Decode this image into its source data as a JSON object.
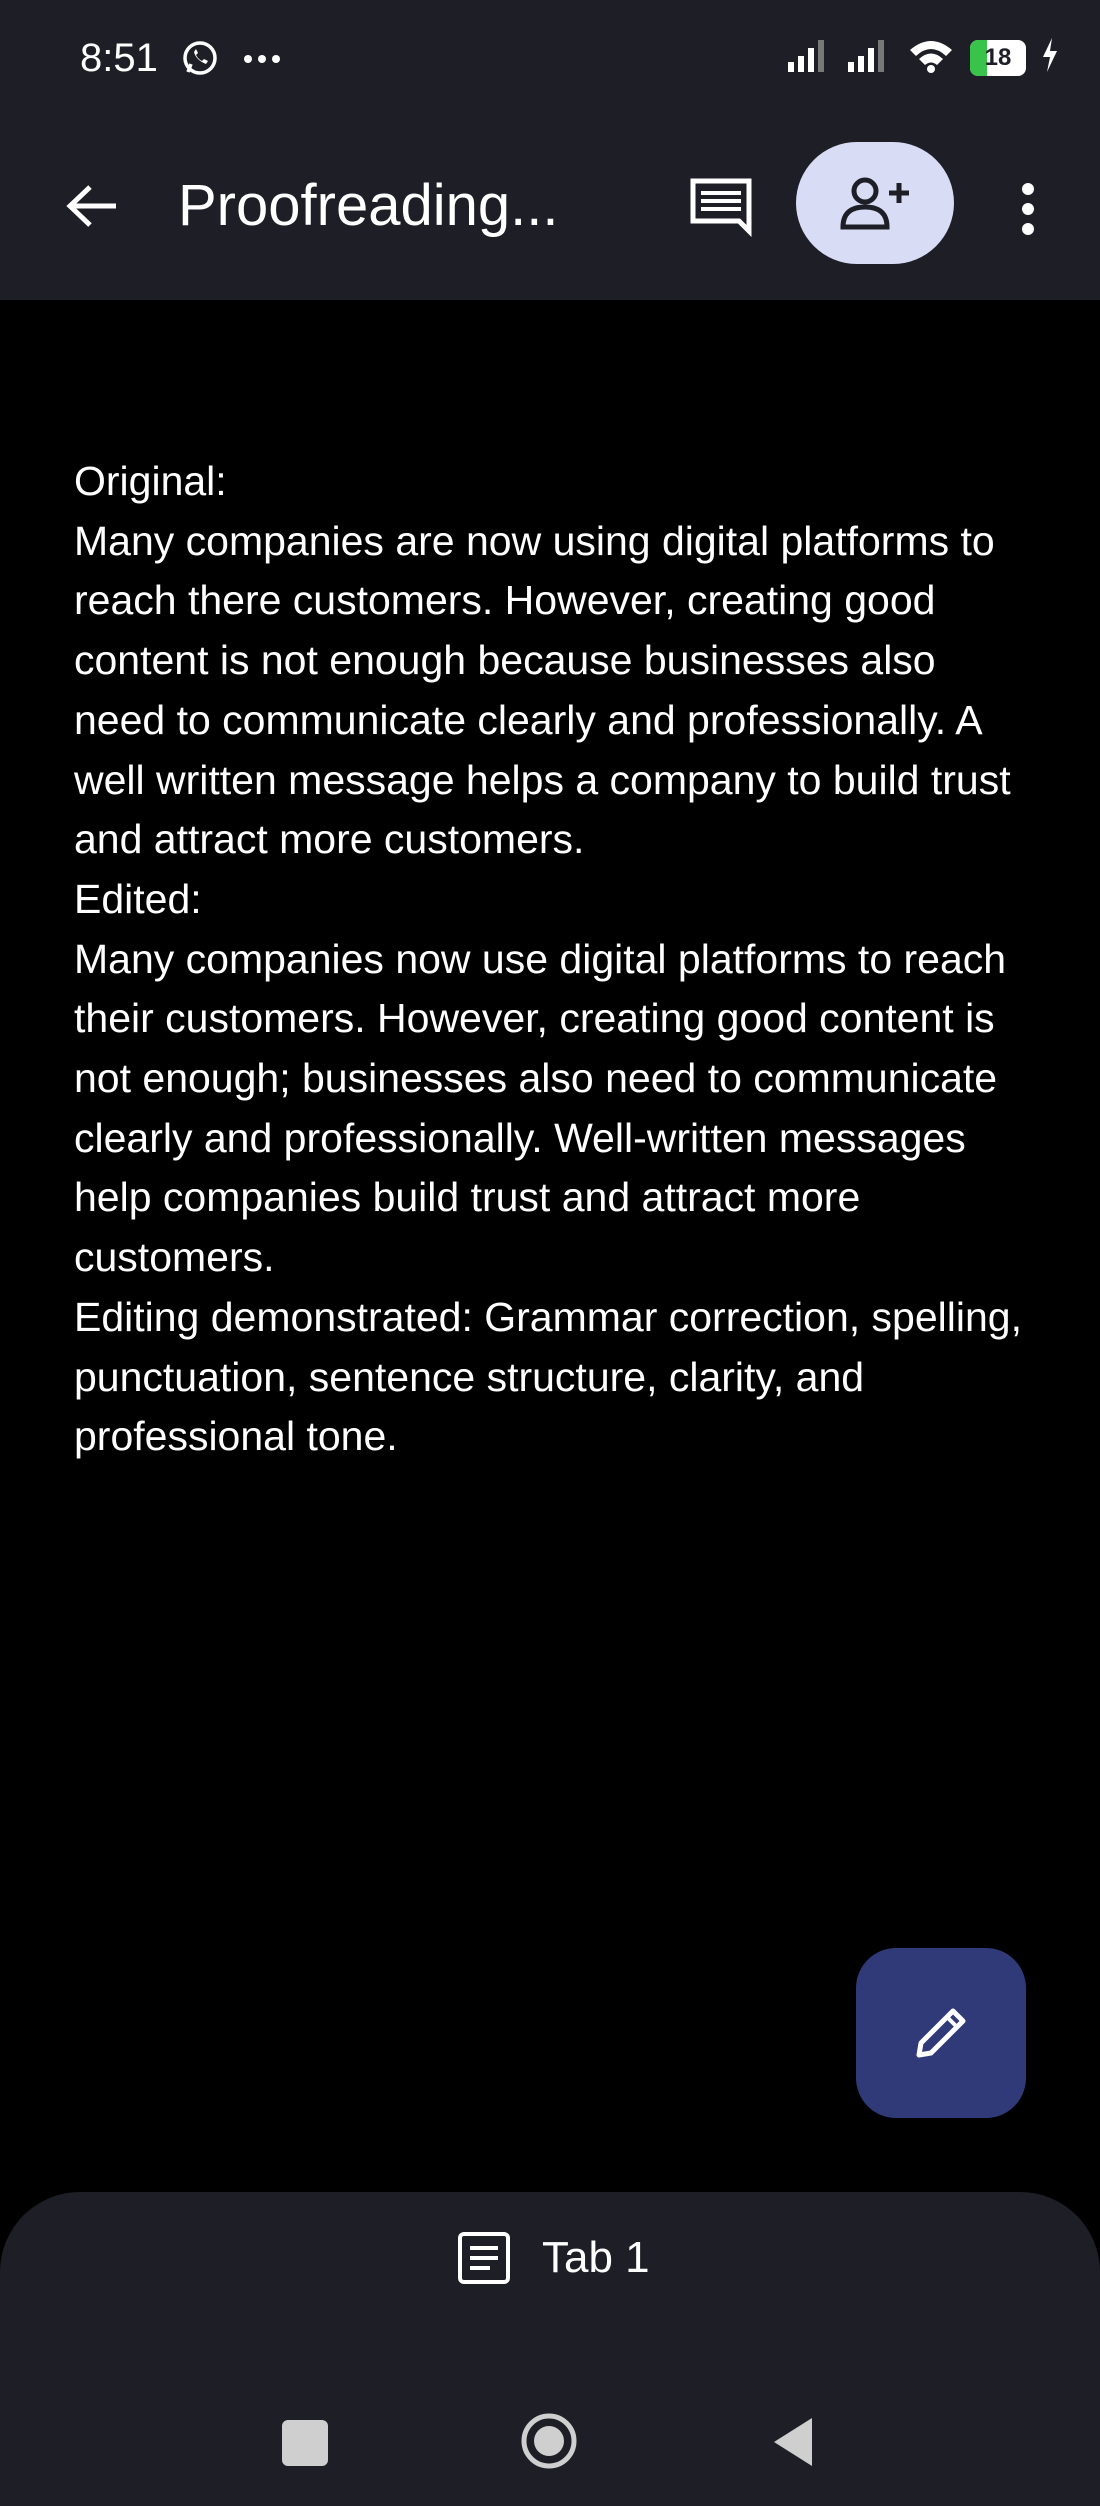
{
  "status_bar": {
    "time": "8:51",
    "left_icons": [
      "whatsapp-icon",
      "more-dots-icon"
    ],
    "right_icons": [
      "signal-icon",
      "signal-icon",
      "wifi-icon",
      "battery-icon",
      "charging-icon"
    ],
    "battery_percent": "18",
    "battery_color": "#3ac34a"
  },
  "app_bar": {
    "title": "Proofreading...",
    "back_icon": "arrow-left-icon",
    "comment_icon": "comment-icon",
    "share_icon": "person-add-icon",
    "more_icon": "more-vert-icon",
    "share_button_color": "#d9dcf5"
  },
  "document": {
    "paragraphs": [
      "Original:",
      "Many companies are now using digital platforms to reach there customers. However, creating good content is not enough because businesses also need to communicate clearly and professionally. A well written message helps a company to build trust and attract more customers.",
      "Edited:",
      "Many companies now use digital platforms to reach their customers. However, creating good content is not enough; businesses also need to communicate clearly and professionally. Well-written messages help companies build trust and attract more customers.",
      "Editing demonstrated: Grammar correction, spelling, punctuation, sentence structure, clarity, and professional tone."
    ]
  },
  "fab": {
    "icon": "pencil-icon",
    "color": "#303a78"
  },
  "bottom_sheet": {
    "tab_icon": "document-icon",
    "tab_label": "Tab 1"
  },
  "nav_bar": {
    "icons": [
      "recents-icon",
      "home-icon",
      "back-icon"
    ]
  }
}
